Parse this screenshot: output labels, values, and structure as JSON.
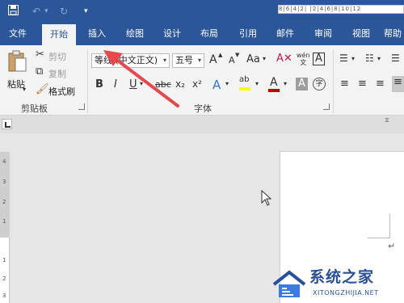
{
  "quick_access": {
    "save_icon": "save-icon",
    "undo_icon": "undo-icon",
    "redo_icon": "redo-icon",
    "customize_icon": "customize-qat-icon"
  },
  "tabs": [
    {
      "label": "文件"
    },
    {
      "label": "开始",
      "active": true
    },
    {
      "label": "插入"
    },
    {
      "label": "绘图"
    },
    {
      "label": "设计"
    },
    {
      "label": "布局"
    },
    {
      "label": "引用"
    },
    {
      "label": "邮件"
    },
    {
      "label": "审阅"
    },
    {
      "label": "视图"
    },
    {
      "label": "帮助"
    }
  ],
  "clipboard": {
    "paste_label": "粘贴",
    "cut_label": "剪切",
    "copy_label": "复制",
    "format_painter_label": "格式刷",
    "group_label": "剪贴板"
  },
  "font": {
    "font_name": "等线 (中文正文)",
    "font_size": "五号",
    "group_label": "字体",
    "grow_glyph": "A",
    "shrink_glyph": "A",
    "case_glyph": "Aa",
    "phonetic_glyph": "wén",
    "border_glyph": "A",
    "bold_glyph": "B",
    "italic_glyph": "I",
    "underline_glyph": "U",
    "strike_glyph": "abc",
    "sub_glyph": "x₂",
    "sup_glyph": "x²",
    "effects_glyph": "A",
    "highlight_glyph": "ab",
    "color_glyph": "A",
    "shading_glyph": "A",
    "enclose_glyph": "字"
  },
  "ruler": {
    "h_ticks": "8|6|4|2| |2|4|6|8|10|12",
    "v_ticks": [
      "4",
      "3",
      "2",
      "1",
      "1",
      "2",
      "3"
    ]
  },
  "watermark": {
    "title": "系统之家",
    "url": "XITONGZHIJIA.NET"
  },
  "colors": {
    "brand": "#2b579a",
    "arrow": "#e5484d",
    "font_color_bar": "#c00000",
    "highlight_bar": "#ffff00"
  }
}
